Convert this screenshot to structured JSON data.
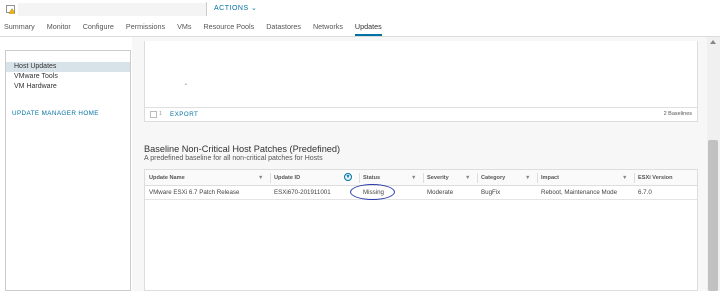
{
  "header": {
    "actions_label": "ACTIONS ⌄",
    "tabs": [
      {
        "label": "Summary"
      },
      {
        "label": "Monitor"
      },
      {
        "label": "Configure"
      },
      {
        "label": "Permissions"
      },
      {
        "label": "VMs"
      },
      {
        "label": "Resource Pools"
      },
      {
        "label": "Datastores"
      },
      {
        "label": "Networks"
      },
      {
        "label": "Updates",
        "active": true
      }
    ]
  },
  "sidebar": {
    "items": [
      {
        "label": "Host Updates",
        "selected": true
      },
      {
        "label": "VMware Tools"
      },
      {
        "label": "VM Hardware"
      }
    ],
    "home_link": "UPDATE MANAGER HOME"
  },
  "baselines_grid": {
    "selected_count": "1",
    "export_label": "EXPORT",
    "total_label": "2 Baselines"
  },
  "baseline": {
    "title": "Baseline Non-Critical Host Patches (Predefined)",
    "description": "A predefined baseline for all non-critical patches for Hosts"
  },
  "table": {
    "columns": [
      "Update Name",
      "Update ID",
      "Status",
      "Severity",
      "Category",
      "Impact",
      "ESXi Version"
    ],
    "rows": [
      {
        "update_name": "VMware ESXi 6.7 Patch Release",
        "update_id": "ESXi670-201911001",
        "status": "Missing",
        "severity": "Moderate",
        "category": "BugFix",
        "impact": "Reboot, Maintenance Mode",
        "esxi_version": "6.7.0"
      }
    ]
  },
  "colors": {
    "accent": "#0072a3",
    "annotation": "#2b3aa8",
    "selected_bg": "#d8e3e9"
  }
}
